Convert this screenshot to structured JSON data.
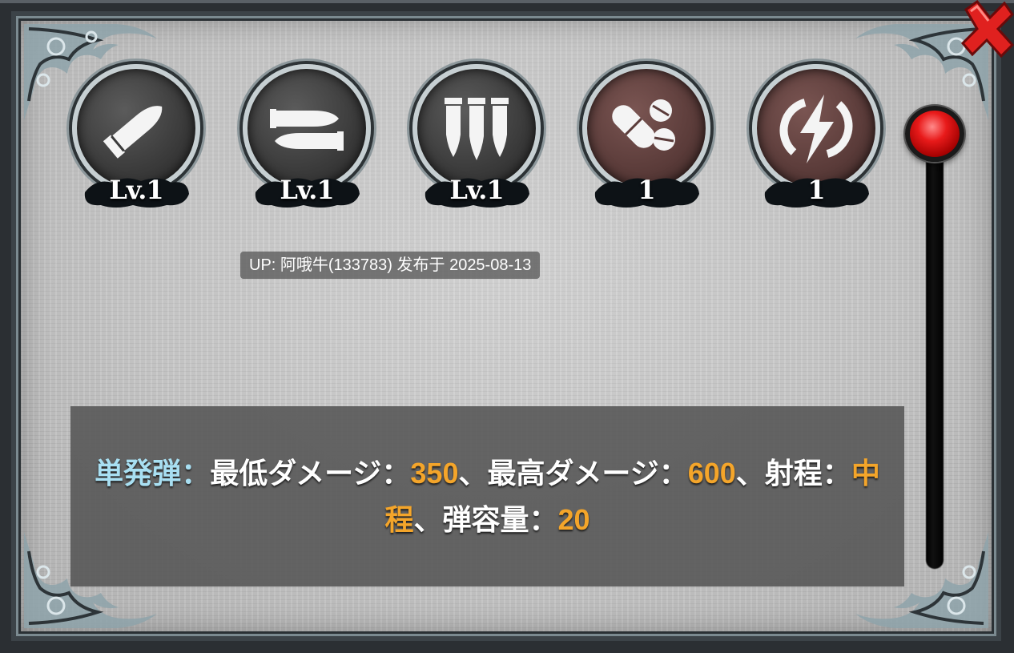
{
  "colors": {
    "value_orange": "#f4a52a",
    "name_cyan": "#a8dff2",
    "close_red": "#e0211f",
    "knob_red": "#e81a1a"
  },
  "skills": [
    {
      "icon": "single-bullet-icon",
      "label": "Lv.1"
    },
    {
      "icon": "double-bullet-icon",
      "label": "Lv.1"
    },
    {
      "icon": "triple-bullet-icon",
      "label": "Lv.1"
    },
    {
      "icon": "pills-icon",
      "label": "1"
    },
    {
      "icon": "energy-bolt-icon",
      "label": "1"
    }
  ],
  "uploader_text": "UP: 阿哦牛(133783) 发布于 2025-08-13",
  "description": {
    "name": "単発弾",
    "colon": "：",
    "min_label": "最低ダメージ：",
    "min_value": "350",
    "sep1": "、",
    "max_label": "最高ダメージ：",
    "max_value": "600",
    "sep2": "、",
    "range_label": "射程：",
    "range_value": "中程",
    "sep3": "、",
    "capacity_label": "弾容量：",
    "capacity_value": "20"
  },
  "slider": {
    "value": 0
  }
}
